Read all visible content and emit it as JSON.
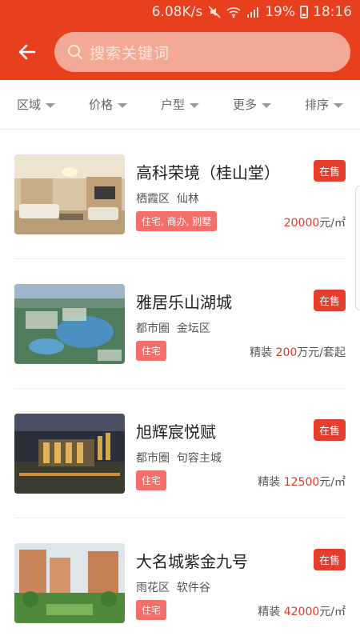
{
  "status_bar": {
    "speed": "6.08K/s",
    "battery": "19%",
    "time": "18:16",
    "icons": [
      "mute-icon",
      "wifi-icon",
      "signal-icon",
      "battery-icon"
    ]
  },
  "header": {
    "back_icon": "back-arrow-icon",
    "search_placeholder": "搜索关键词",
    "accent": "#e8401f"
  },
  "filters": [
    {
      "label": "区域"
    },
    {
      "label": "价格"
    },
    {
      "label": "户型"
    },
    {
      "label": "更多"
    },
    {
      "label": "排序"
    }
  ],
  "listings": [
    {
      "title": "高科荣境（桂山堂）",
      "status": "在售",
      "district": "栖霞区",
      "area": "仙林",
      "tag": "住宅, 商办, 别墅",
      "price_prefix": "",
      "price_value": "20000",
      "price_unit": "元/㎡"
    },
    {
      "title": "雅居乐山湖城",
      "status": "在售",
      "district": "都市圈",
      "area": "金坛区",
      "tag": "住宅",
      "price_prefix": "精装",
      "price_value": "200",
      "price_unit": "万元/套起"
    },
    {
      "title": "旭辉宸悦赋",
      "status": "在售",
      "district": "都市圈",
      "area": "句容主城",
      "tag": "住宅",
      "price_prefix": "精装",
      "price_value": "12500",
      "price_unit": "元/㎡"
    },
    {
      "title": "大名城紫金九号",
      "status": "在售",
      "district": "雨花区",
      "area": "软件谷",
      "tag": "住宅",
      "price_prefix": "精装",
      "price_value": "42000",
      "price_unit": "元/㎡"
    }
  ]
}
